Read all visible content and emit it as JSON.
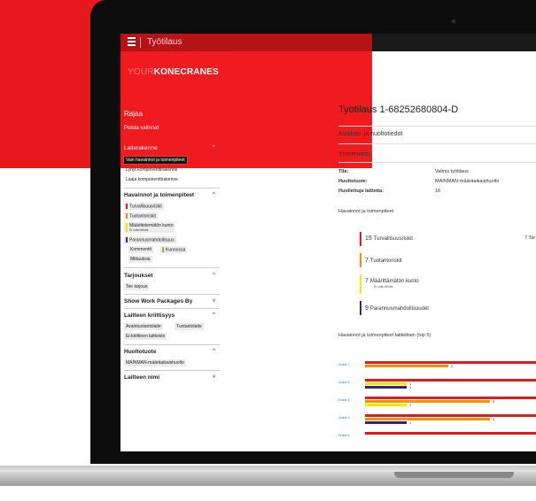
{
  "header": {
    "title": "Työtilaus"
  },
  "logo": {
    "prefix": "YOUR",
    "brand": "KONECRANES"
  },
  "sidebar": {
    "rajaa": "Rajaa",
    "poista": "Poista valinnat",
    "laiterakenne": {
      "title": "Laiterakenne",
      "items": [
        "Vain havainnot ja toimenpiteet",
        "Lyhyt komponenttirakenne",
        "Laaja komponenttirakenne"
      ]
    },
    "havainnot": {
      "title": "Havainnot ja toimenpiteet",
      "items": [
        {
          "label": "Turvallisuusriskit",
          "color": "#e8191c"
        },
        {
          "label": "Tuotantoriskit",
          "color": "#f39200"
        },
        {
          "label": "Määrittelemätön kunto",
          "sub": "Ei voitu tehdä",
          "color": "#ffe600"
        },
        {
          "label": "Parannusmahdollisuus",
          "color": "#2b2a83"
        }
      ],
      "kommentti": "Kommentti",
      "kunnossa": "Kunnossa",
      "mittauksia": "Mittauksia",
      "kunnossa_color": "#7ac943"
    },
    "tarjoukset": {
      "title": "Tarjoukset",
      "items": [
        "Tee tarjous"
      ]
    },
    "show_packages": {
      "title": "Show Work Packages By"
    },
    "kriittisyys": {
      "title": "Laitteen kriittisyys",
      "items": [
        "Avaintuotantolaite",
        "Tuotantolaite",
        "Ei-kriittinen laitteisto"
      ]
    },
    "huoltotuote": {
      "title": "Huoltotuote",
      "items": [
        "MAINMAN-määräaikaishuolto"
      ]
    },
    "laitteen_nimi": {
      "title": "Laitteen nimi"
    }
  },
  "main": {
    "title": "Työtilaus 1-68252680804-D",
    "asiakas": "Asiakas- ja huoltotiedot",
    "yhteenveto": "Yhteenveto",
    "summary": [
      {
        "key": "Tila:",
        "value": "Valmis työtilaus"
      },
      {
        "key": "Huoltotuote:",
        "value": "MAINMAN-määräaikaishuolto"
      },
      {
        "key": "Huollettuja laitteita:",
        "value": "16"
      }
    ],
    "havainnot_title": "Havainnot ja toimenpiteet",
    "stats": [
      {
        "count": "15",
        "label": "Turvallisuusriskit",
        "color": "#e8191c"
      },
      {
        "count": "7",
        "label": "Tuotantoriskit",
        "color": "#f39200"
      },
      {
        "count": "7",
        "label": "Määrittämätön kunto",
        "sub": "Ei voitu tehdä",
        "color": "#ffe600"
      },
      {
        "count": "9",
        "label": "Parannusmahdollisuudet",
        "color": "#2b2a83"
      }
    ],
    "right_cut": "7 Tar",
    "chart_title": "Havainnot ja toimenpiteet laitteittain (top 5)"
  },
  "chart_data": {
    "type": "bar",
    "title": "Havainnot ja toimenpiteet laitteittain (top 5)",
    "categories": [
      "Crane 7",
      "Crane 6",
      "Crane 4",
      "Crane 3",
      "Crane 5"
    ],
    "series": [
      {
        "color": "#e8191c",
        "values": [
          null,
          null,
          null,
          null,
          null
        ]
      },
      {
        "color": "#f39200",
        "values": [
          2,
          null,
          3,
          3,
          null
        ]
      },
      {
        "color": "#ffe600",
        "values": [
          null,
          1,
          1,
          null,
          null
        ]
      },
      {
        "color": "#2b2a83",
        "values": [
          null,
          1,
          null,
          1,
          null
        ]
      }
    ]
  }
}
